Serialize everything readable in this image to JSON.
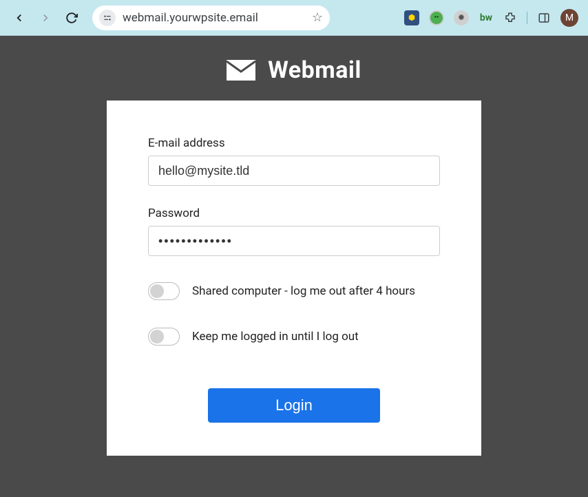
{
  "browser": {
    "url": "webmail.yourwpsite.email",
    "avatar_initial": "M"
  },
  "logo": {
    "text": "Webmail"
  },
  "form": {
    "email_label": "E-mail address",
    "email_value": "hello@mysite.tld",
    "password_label": "Password",
    "password_value": "•••••••••••••",
    "shared_label": "Shared computer - log me out after 4 hours",
    "keep_label": "Keep me logged in until I log out",
    "submit_label": "Login"
  }
}
